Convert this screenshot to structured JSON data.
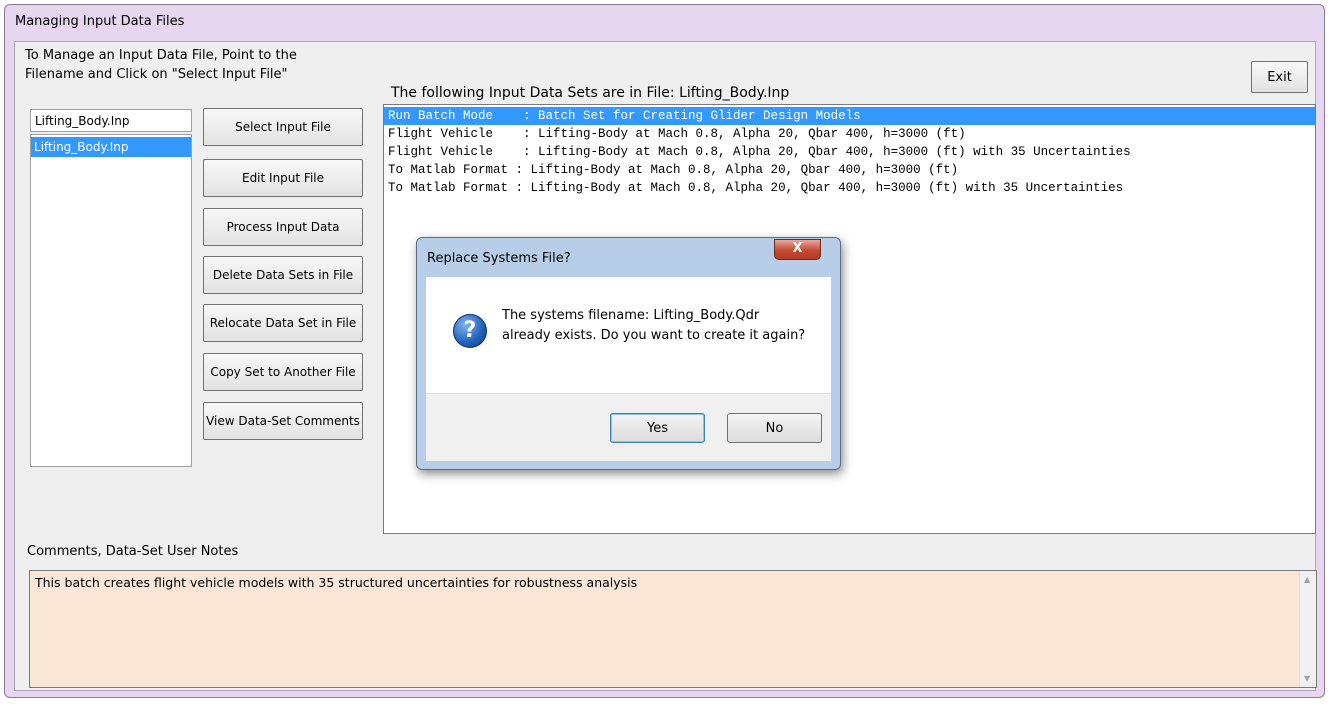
{
  "window": {
    "title": "Managing Input Data Files"
  },
  "instructions": {
    "line1": "To Manage an Input Data File, Point to the",
    "line2": "Filename and Click on \"Select Input File\""
  },
  "file_input": {
    "value": "Lifting_Body.Inp"
  },
  "file_list": {
    "items": [
      "Lifting_Body.Inp"
    ]
  },
  "buttons": {
    "select": "Select Input File",
    "edit": "Edit Input File",
    "process": "Process Input Data",
    "delete": "Delete Data Sets in File",
    "relocate": "Relocate Data Set in File",
    "copy": "Copy Set to Another File",
    "view": "View Data-Set Comments",
    "exit": "Exit"
  },
  "datasets": {
    "header": "The following Input Data Sets are in File: Lifting_Body.Inp",
    "rows": [
      "Run Batch Mode    : Batch Set for Creating Glider Design Models",
      "Flight Vehicle    : Lifting-Body at Mach 0.8, Alpha 20, Qbar 400, h=3000 (ft)",
      "Flight Vehicle    : Lifting-Body at Mach 0.8, Alpha 20, Qbar 400, h=3000 (ft) with 35 Uncertainties",
      "To Matlab Format : Lifting-Body at Mach 0.8, Alpha 20, Qbar 400, h=3000 (ft)",
      "To Matlab Format : Lifting-Body at Mach 0.8, Alpha 20, Qbar 400, h=3000 (ft) with 35 Uncertainties"
    ]
  },
  "comments": {
    "label": "Comments, Data-Set User Notes",
    "text": "This batch creates flight vehicle models with 35 structured uncertainties  for robustness analysis"
  },
  "dialog": {
    "title": "Replace Systems File?",
    "close": "X",
    "icon": "?",
    "message_line1": "The systems filename: Lifting_Body.Qdr",
    "message_line2": "already exists. Do you want to create it again?",
    "yes": "Yes",
    "no": "No"
  },
  "colors": {
    "selection": "#3399ff",
    "window_frame": "#e6d6f0",
    "comments_bg": "#fae6d6",
    "dialog_frame": "#b7cde8",
    "close_button": "#c44a32"
  }
}
